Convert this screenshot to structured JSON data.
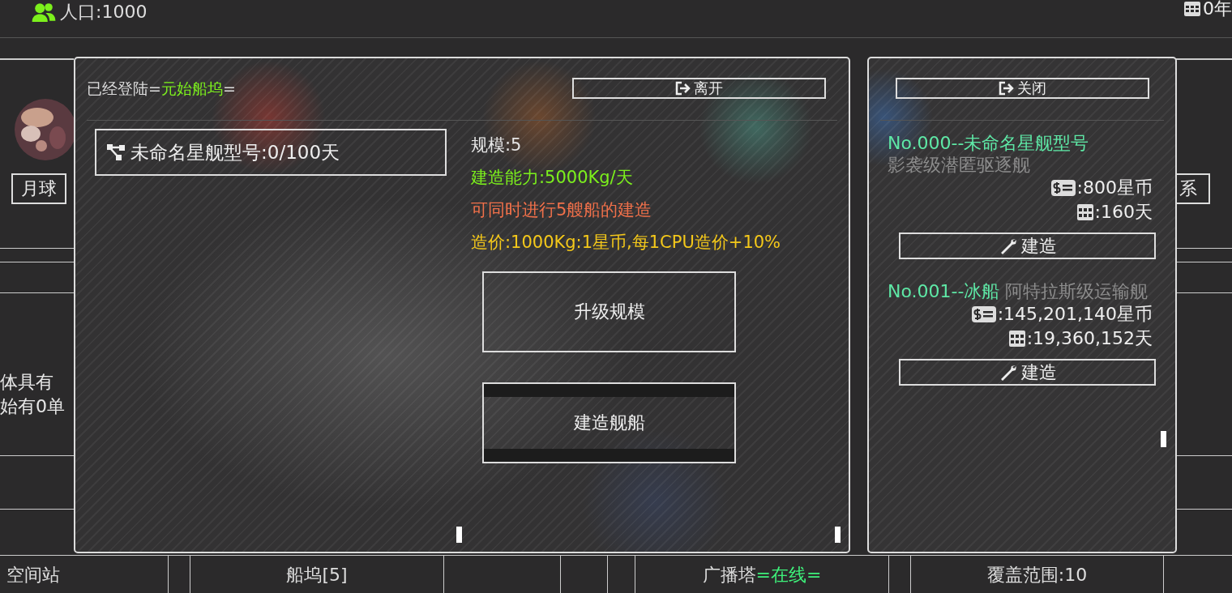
{
  "top_bar": {
    "population": "人口:1000",
    "date": "0年"
  },
  "background": {
    "planet_label": "月球",
    "text_lines": [
      "体具有",
      "始有0单"
    ],
    "right_label": "系"
  },
  "dock_dialog": {
    "title_prefix": "已经登陆=",
    "dock_name": "元始船坞",
    "title_suffix": "=",
    "leave_button": "离开",
    "queue": [
      {
        "text": "未命名星舰型号:0/100天"
      }
    ],
    "stats": [
      {
        "text": "规模:5",
        "color": "#e6e6e6"
      },
      {
        "text": "建造能力:5000Kg/天",
        "color": "#7cf01c"
      },
      {
        "text": "可同时进行5艘船的建造",
        "color": "#f0704a"
      },
      {
        "text": "造价:1000Kg:1星币,每1CPU造价+10%",
        "color": "#f4c81a"
      }
    ],
    "upgrade_button": "升级规模",
    "build_ship_button": {
      "label": "建造舰船",
      "selected": true
    }
  },
  "blueprints_dialog": {
    "close_button": "关闭",
    "ships": [
      {
        "name": "No.000--未命名星舰型号",
        "class": "影袭级潜匿驱逐舰",
        "cost": ":800星币",
        "time": ":160天",
        "build_button": "建造"
      },
      {
        "name": "No.001--冰船",
        "class": "阿特拉斯级运输舰",
        "cost": ":145,201,140星币",
        "time": ":19,360,152天",
        "build_button": "建造"
      }
    ]
  },
  "bottom_bar": {
    "cells": [
      {
        "label": "空间站"
      },
      {
        "label": "船坞[5]"
      },
      {
        "label": "广播塔",
        "status": "=在线="
      },
      {
        "label": "覆盖范围:10"
      }
    ]
  }
}
